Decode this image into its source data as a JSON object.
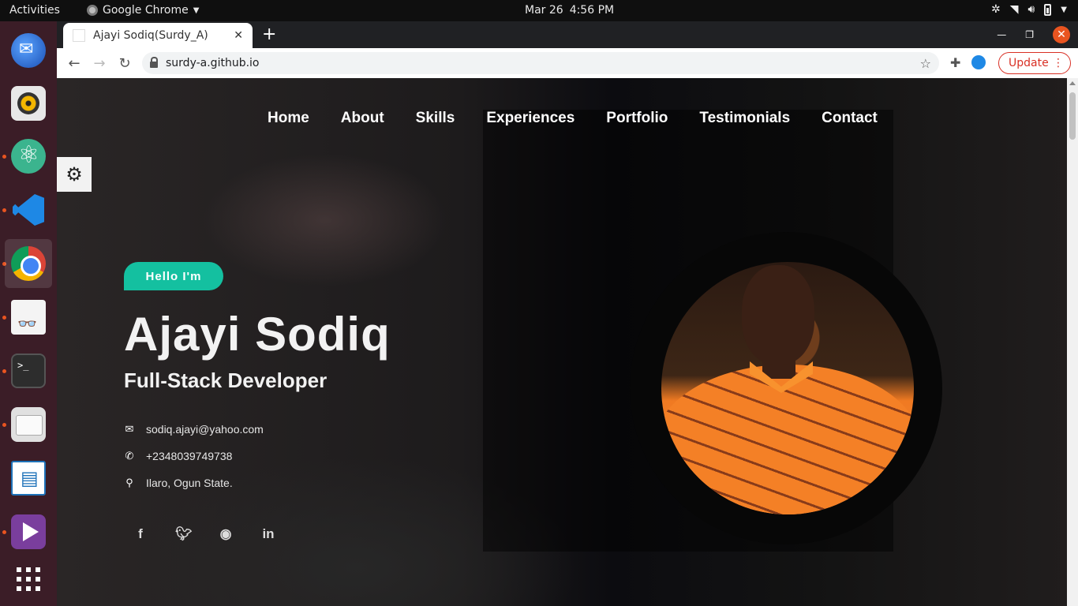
{
  "topbar": {
    "activities": "Activities",
    "app_name": "Google Chrome",
    "date": "Mar 26",
    "time": "4:56 PM"
  },
  "dock": {
    "items": [
      "thunderbird-icon",
      "rhythmbox-icon",
      "atom-icon",
      "vscode-icon",
      "chrome-icon",
      "document-viewer-icon",
      "terminal-icon",
      "files-icon",
      "libreoffice-writer-icon",
      "video-player-icon",
      "show-apps-icon"
    ]
  },
  "browser": {
    "tab_title": "Ajayi Sodiq(Surdy_A)",
    "url": "surdy-a.github.io",
    "update_label": "Update"
  },
  "page": {
    "nav": [
      "Home",
      "About",
      "Skills",
      "Experiences",
      "Portfolio",
      "Testimonials",
      "Contact"
    ],
    "hello": "Hello I'm",
    "name": "Ajayi Sodiq",
    "role": "Full-Stack Developer",
    "email": "sodiq.ajayi@yahoo.com",
    "phone": "+2348039749738",
    "location": "Ilaro, Ogun State.",
    "socials": [
      "facebook-icon",
      "twitter-icon",
      "github-icon",
      "linkedin-icon"
    ]
  },
  "colors": {
    "accent": "#14c0a0",
    "ubuntu_orange": "#e95420",
    "update_red": "#d93025"
  }
}
